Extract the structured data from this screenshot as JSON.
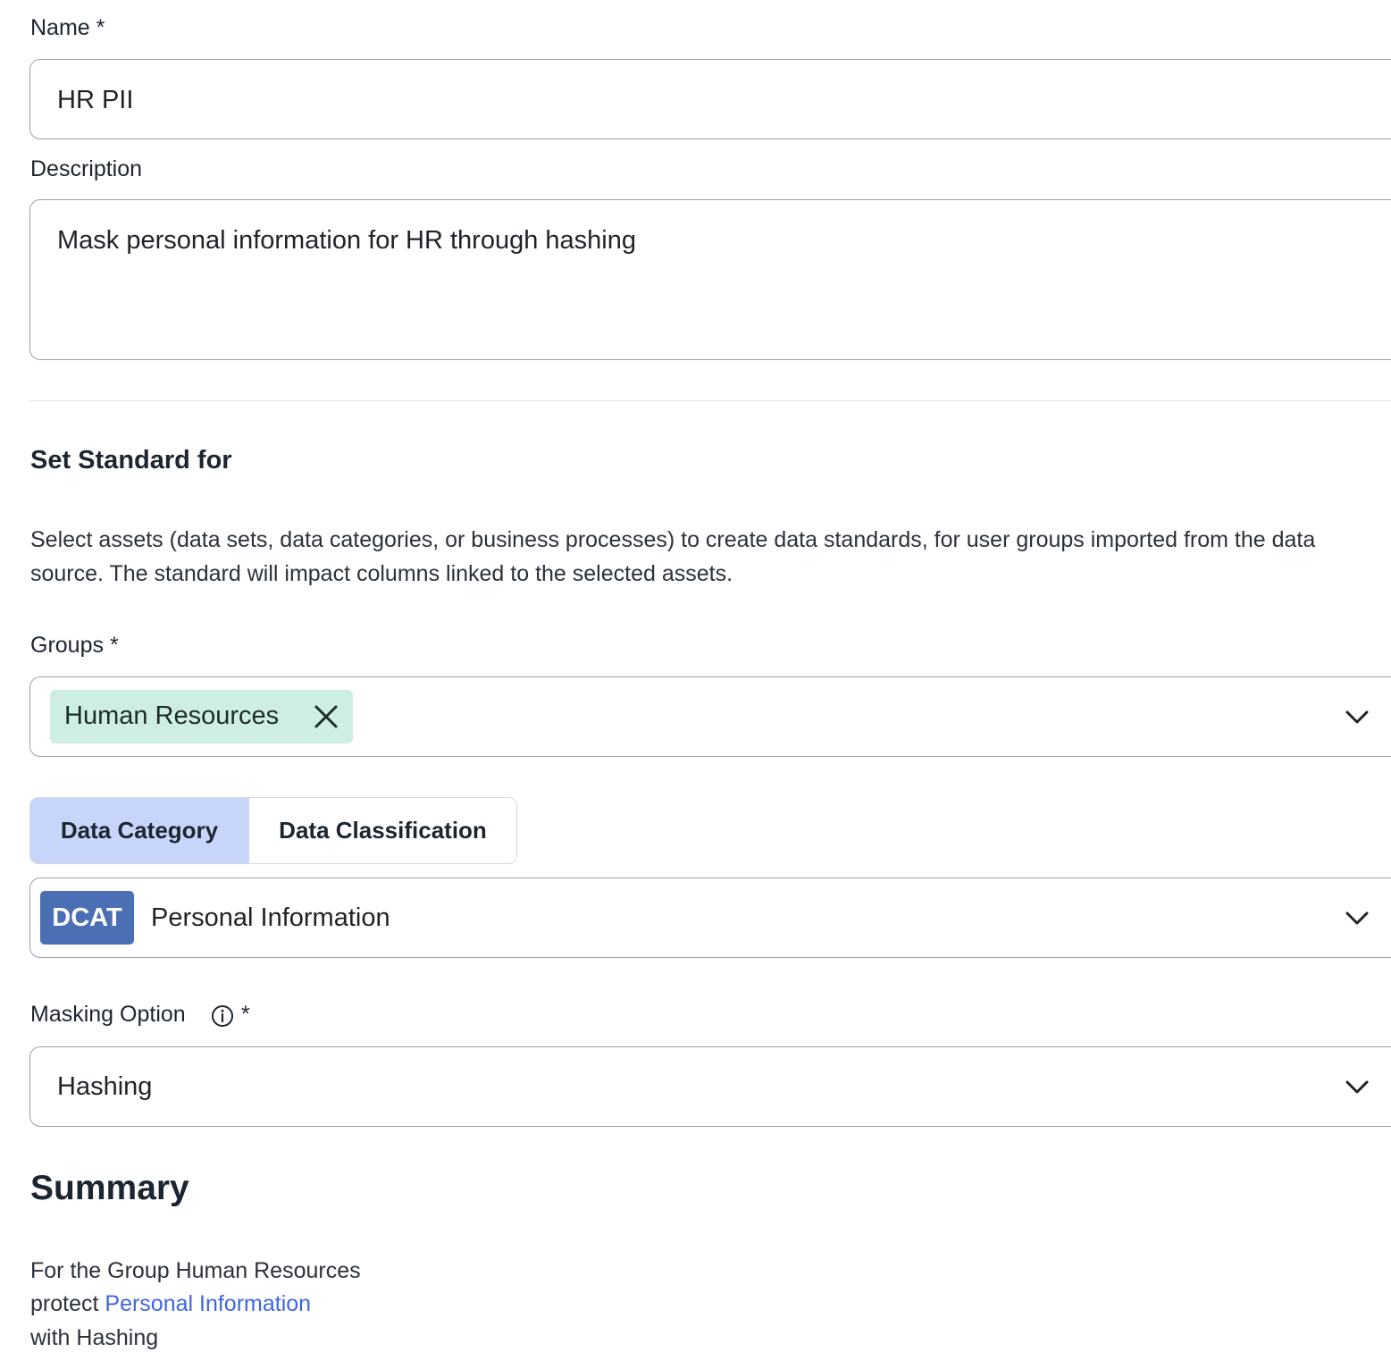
{
  "form": {
    "name_label": "Name",
    "required_mark": "*",
    "name_value": "HR PII",
    "description_label": "Description",
    "description_value": "Mask personal information for HR through hashing"
  },
  "standard": {
    "title": "Set Standard for",
    "description": "Select assets (data sets, data categories, or business processes) to create data standards, for user groups imported from the data source. The standard will impact columns linked to the selected assets.",
    "groups_label": "Groups",
    "selected_group": "Human Resources",
    "tabs": [
      {
        "label": "Data Category",
        "active": true
      },
      {
        "label": "Data Classification",
        "active": false
      }
    ],
    "category_badge": "DCAT",
    "category_value": "Personal Information",
    "masking_label": "Masking Option",
    "masking_value": "Hashing"
  },
  "summary": {
    "title": "Summary",
    "line1": "For the Group Human Resources",
    "line2_prefix": "protect",
    "line2_link": "Personal Information",
    "line3": "with Hashing"
  },
  "colors": {
    "chip_bg": "#cdeee0",
    "active_tab_bg": "#c8d5fb",
    "badge_bg": "#4a6fb5",
    "link": "#3f66e0"
  },
  "icons": {
    "chip_close": "close-icon",
    "dropdown": "chevron-down-icon",
    "info": "info-icon"
  }
}
